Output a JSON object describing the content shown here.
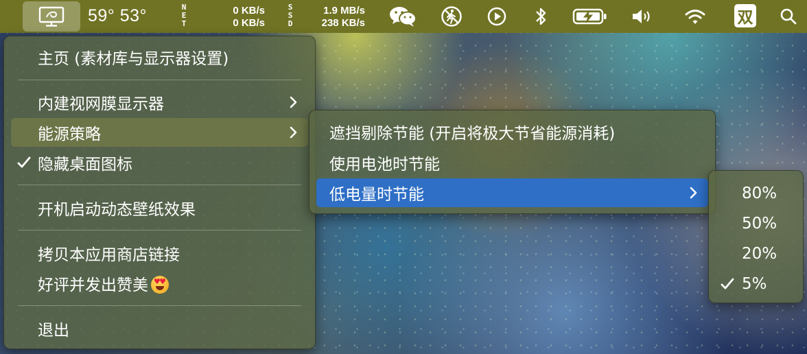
{
  "menubar": {
    "temperatures": "59° 53°",
    "net": {
      "label": "NET",
      "up": "0 KB/s",
      "down": "0 KB/s"
    },
    "ssd": {
      "label": "SSD",
      "read": "1.9 MB/s",
      "write": "238 KB/s"
    },
    "input_method": "双",
    "icons": [
      "app-display-icon",
      "wechat-icon",
      "no-running-icon",
      "play-icon",
      "bluetooth-icon",
      "battery-charging-icon",
      "volume-icon",
      "wifi-icon",
      "input-method-icon",
      "search-icon"
    ]
  },
  "main_menu": {
    "items": [
      {
        "label": "主页 (素材库与显示器设置)"
      },
      {
        "label": "内建视网膜显示器",
        "submenu": true
      },
      {
        "label": "能源策略",
        "submenu": true,
        "highlighted": true
      },
      {
        "label": "隐藏桌面图标",
        "checked": true
      },
      {
        "label": "开机启动动态壁纸效果"
      },
      {
        "label": "拷贝本应用商店链接"
      },
      {
        "label": "好评并发出赞美",
        "emoji": "heart-eyes-emoji"
      },
      {
        "label": "退出"
      }
    ]
  },
  "energy_menu": {
    "items": [
      {
        "label": "遮挡剔除节能 (开启将极大节省能源消耗)"
      },
      {
        "label": "使用电池时节能"
      },
      {
        "label": "低电量时节能",
        "submenu": true,
        "selected": true
      }
    ]
  },
  "battery_menu": {
    "items": [
      {
        "label": "80%"
      },
      {
        "label": "50%"
      },
      {
        "label": "20%"
      },
      {
        "label": "5%",
        "checked": true
      }
    ]
  },
  "colors": {
    "menubar": "#707324",
    "selection_blue": "#2f6fc6",
    "menu_bg": "#5c6844"
  }
}
